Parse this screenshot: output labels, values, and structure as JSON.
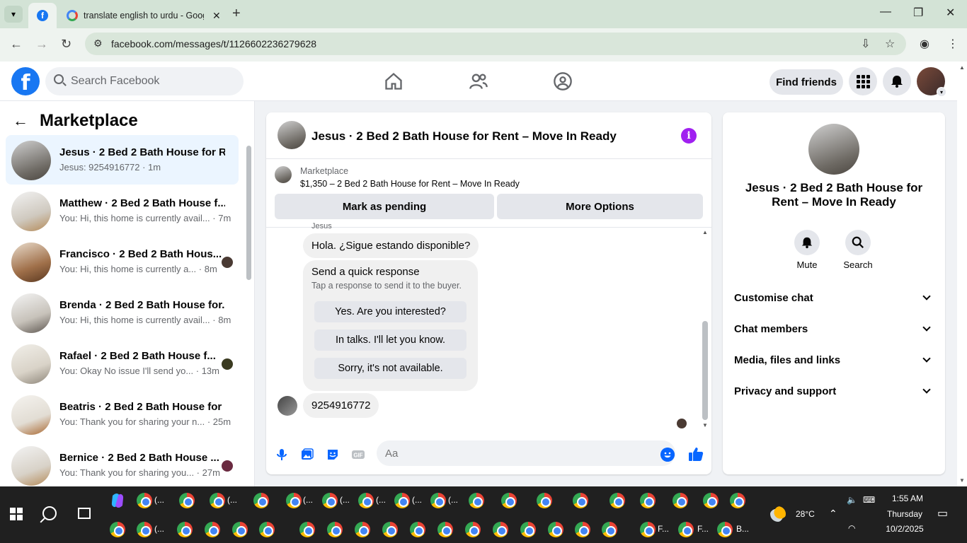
{
  "browser": {
    "tabs": [
      {
        "title": "",
        "icon": "facebook-icon",
        "active": true
      },
      {
        "title": "translate english to urdu - Goog",
        "icon": "google-icon",
        "active": false
      }
    ],
    "url": "facebook.com/messages/t/1126602236279628"
  },
  "fb": {
    "search_placeholder": "Search Facebook",
    "find_friends": "Find friends"
  },
  "sidebar": {
    "title": "Marketplace",
    "conversations": [
      {
        "name": "Jesus · 2 Bed 2 Bath House for R...",
        "snippet": "Jesus: 9254916772 · 1m",
        "selected": true
      },
      {
        "name": "Matthew · 2 Bed 2 Bath House f...",
        "snippet": "You: Hi, this home is currently avail... · 7m"
      },
      {
        "name": "Francisco · 2 Bed 2 Bath Hous...",
        "snippet": "You: Hi, this home is currently a... · 8m"
      },
      {
        "name": "Brenda · 2 Bed 2 Bath House for...",
        "snippet": "You: Hi, this home is currently avail... · 8m"
      },
      {
        "name": "Rafael · 2 Bed 2 Bath House f...",
        "snippet": "You: Okay No issue I'll send yo... · 13m"
      },
      {
        "name": "Beatris · 2 Bed 2 Bath House for ...",
        "snippet": "You: Thank you for sharing your n... · 25m"
      },
      {
        "name": "Bernice · 2 Bed 2 Bath House ...",
        "snippet": "You: Thank you for sharing you... · 27m"
      }
    ]
  },
  "chat": {
    "title": "Jesus · 2 Bed 2 Bath House for Rent – Move In Ready",
    "marketplace_label": "Marketplace",
    "listing": "$1,350 – 2 Bed 2 Bath House for Rent – Move In Ready",
    "mark_pending": "Mark as pending",
    "more_options": "More Options",
    "sender_peek": "Jesus",
    "message_1": "Hola. ¿Sigue estando disponible?",
    "quick_title": "Send a quick response",
    "quick_subtitle": "Tap a response to send it to the buyer.",
    "quick_replies": [
      "Yes. Are you interested?",
      "In talks. I'll let you know.",
      "Sorry, it's not available."
    ],
    "message_2": "9254916772",
    "composer_placeholder": "Aa"
  },
  "info_panel": {
    "title": "Jesus · 2 Bed 2 Bath House for Rent – Move In Ready",
    "mute": "Mute",
    "search": "Search",
    "sections": [
      "Customise chat",
      "Chat members",
      "Media, files and links",
      "Privacy and support"
    ]
  },
  "taskbar": {
    "weather": "28°C",
    "time": "1:55 AM",
    "day": "Thursday",
    "date": "10/2/2025",
    "labels": [
      "(...",
      "(...",
      "(...",
      "(...",
      "(...",
      "(...",
      "(...",
      "(...",
      "F...",
      "B..."
    ]
  }
}
